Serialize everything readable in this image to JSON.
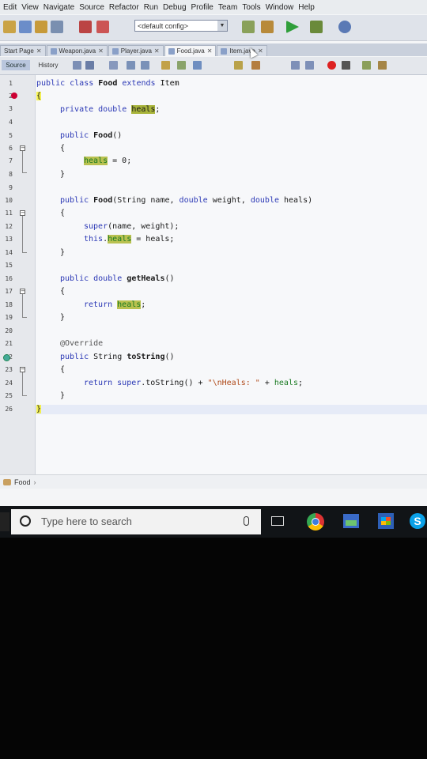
{
  "menu": [
    "Edit",
    "View",
    "Navigate",
    "Source",
    "Refactor",
    "Run",
    "Debug",
    "Profile",
    "Team",
    "Tools",
    "Window",
    "Help"
  ],
  "toolbar": {
    "config_value": "<default config>"
  },
  "tabs": [
    {
      "label": "Start Page",
      "active": false
    },
    {
      "label": "Weapon.java",
      "active": false
    },
    {
      "label": "Player.java",
      "active": false
    },
    {
      "label": "Food.java",
      "active": true
    },
    {
      "label": "Item.java",
      "active": false
    }
  ],
  "editor_toolbar": {
    "source_label": "Source",
    "history_label": "History"
  },
  "code": {
    "line_numbers": [
      "1",
      "2",
      "3",
      "4",
      "5",
      "6",
      "7",
      "8",
      "9",
      "10",
      "11",
      "12",
      "13",
      "14",
      "15",
      "16",
      "17",
      "18",
      "19",
      "20",
      "21",
      "22",
      "23",
      "24",
      "25",
      "26"
    ],
    "l1_a": "public class ",
    "l1_b": "Food",
    "l1_c": " extends ",
    "l1_d": "Item",
    "l2": "{",
    "l3_a": "private double ",
    "l3_b": "heals",
    "l3_c": ";",
    "l5_a": "public ",
    "l5_b": "Food",
    "l5_c": "()",
    "l6": "{",
    "l7_a": "heals",
    "l7_b": " = 0;",
    "l8": "}",
    "l10_a": "public ",
    "l10_b": "Food",
    "l10_c": "(String name, ",
    "l10_d": "double",
    "l10_e": " weight, ",
    "l10_f": "double",
    "l10_g": " heals)",
    "l11": "{",
    "l12_a": "super",
    "l12_b": "(name, weight);",
    "l13_a": "this",
    "l13_b": ".",
    "l13_c": "heals",
    "l13_d": " = heals;",
    "l14": "}",
    "l16_a": "public double ",
    "l16_b": "getHeals",
    "l16_c": "()",
    "l17": "{",
    "l18_a": "return ",
    "l18_b": "heals",
    "l18_c": ";",
    "l19": "}",
    "l21": "@Override",
    "l22_a": "public ",
    "l22_b": "String ",
    "l22_c": "toString",
    "l22_d": "()",
    "l23": "{",
    "l24_a": "return ",
    "l24_b": "super",
    "l24_c": ".toString() + ",
    "l24_d": "\"\\nHeals: \"",
    "l24_e": " + ",
    "l24_f": "heals",
    "l24_g": ";",
    "l25": "}",
    "l26": "}"
  },
  "breadcrumb": {
    "label": "Food"
  },
  "taskbar": {
    "search_placeholder": "Type here to search",
    "skype_letter": "S"
  }
}
